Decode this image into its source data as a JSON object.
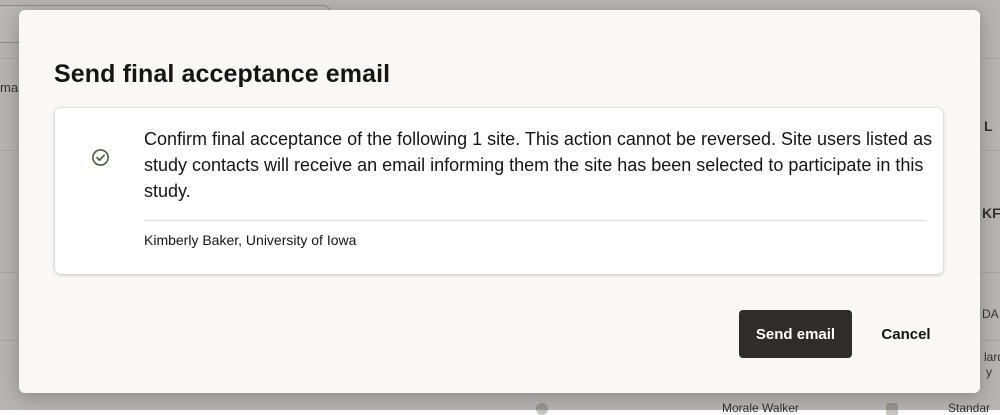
{
  "background": {
    "fragments": [
      "mar",
      "L",
      "KF",
      "DA",
      "lard",
      "y",
      "Morale Walker",
      "Standar"
    ]
  },
  "dialog": {
    "title": "Send final acceptance email",
    "message": "Confirm final acceptance of the following 1 site. This action cannot be reversed. Site users listed as study contacts will receive an email informing them the site has been selected to participate in this study.",
    "sites": [
      "Kimberly Baker, University of Iowa"
    ],
    "status_icon": "check-circle-icon",
    "send_label": "Send email",
    "cancel_label": "Cancel"
  },
  "colors": {
    "primary_button": "#302c29",
    "success_icon": "#4b5f3a",
    "dialog_bg": "#f9f8f6"
  }
}
